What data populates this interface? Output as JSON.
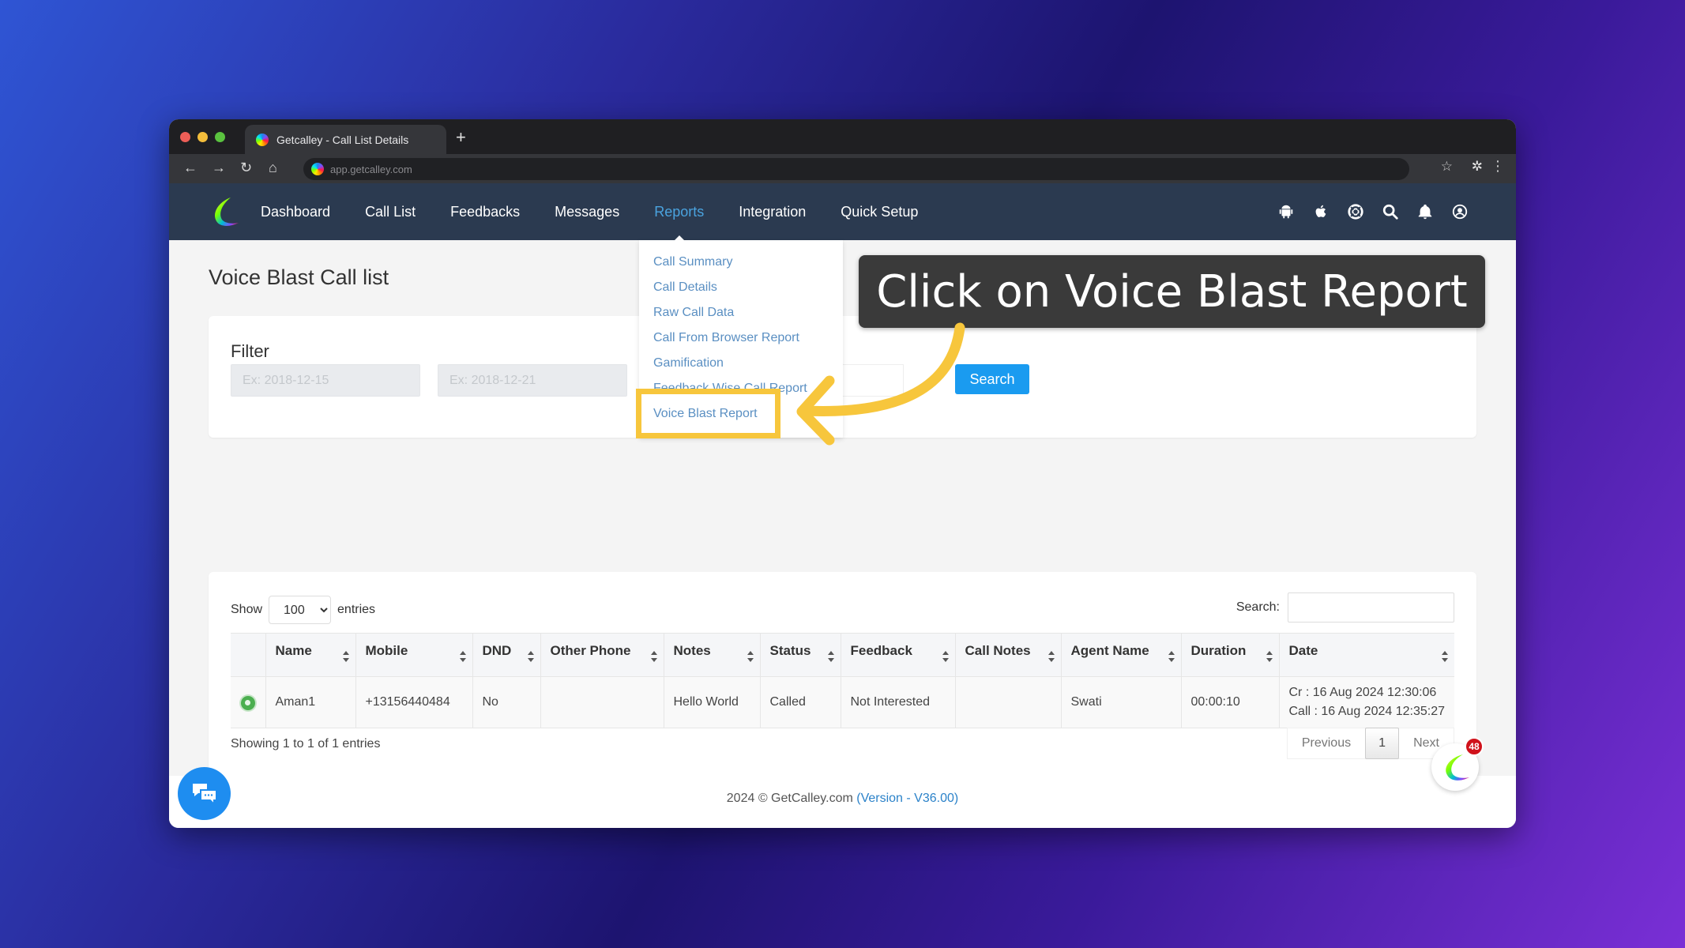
{
  "browser": {
    "tab_title": "Getcalley - Call List Details",
    "new_tab_icon": "plus-icon",
    "url": "app.getcalley.com",
    "nav_icons": [
      "back-arrow-icon",
      "forward-arrow-icon",
      "reload-icon",
      "home-icon"
    ],
    "right_icons": [
      "bookmark-star-icon",
      "extensions-puzzle-icon",
      "kebab-menu-icon"
    ]
  },
  "nav": {
    "items": [
      {
        "label": "Dashboard",
        "active": false
      },
      {
        "label": "Call List",
        "active": false
      },
      {
        "label": "Feedbacks",
        "active": false
      },
      {
        "label": "Messages",
        "active": false
      },
      {
        "label": "Reports",
        "active": true
      },
      {
        "label": "Integration",
        "active": false
      },
      {
        "label": "Quick Setup",
        "active": false
      }
    ],
    "right_icons": [
      "android-icon",
      "apple-icon",
      "support-lifebuoy-icon",
      "search-icon",
      "bell-icon",
      "user-account-icon"
    ]
  },
  "reports_menu": {
    "items": [
      "Call Summary",
      "Call Details",
      "Raw Call Data",
      "Call From Browser Report",
      "Gamification",
      "Feedback Wise Call Report",
      "Voice Blast Report"
    ],
    "highlighted": "Voice Blast Report"
  },
  "page": {
    "title": "Voice Blast Call list"
  },
  "filter": {
    "label": "Filter",
    "from_placeholder": "Ex: 2018-12-15",
    "to_placeholder": "Ex: 2018-12-21",
    "search_button": "Search"
  },
  "table": {
    "show_label": "Show",
    "entries_label": "entries",
    "page_size": "100",
    "search_label": "Search:",
    "search_value": "",
    "columns": [
      "",
      "Name",
      "Mobile",
      "DND",
      "Other Phone",
      "Notes",
      "Status",
      "Feedback",
      "Call Notes",
      "Agent Name",
      "Duration",
      "Date"
    ],
    "rows": [
      {
        "name": "Aman1",
        "mobile": "+13156440484",
        "dnd": "No",
        "other_phone": "",
        "notes": "Hello World",
        "status": "Called",
        "feedback": "Not Interested",
        "call_notes": "",
        "agent_name": "Swati",
        "duration": "00:00:10",
        "date_created": "Cr : 16 Aug 2024 12:30:06",
        "date_call": "Call : 16 Aug 2024 12:35:27"
      }
    ],
    "info": "Showing 1 to 1 of 1 entries",
    "pagination": {
      "previous": "Previous",
      "current": "1",
      "next": "Next"
    }
  },
  "footer": {
    "copyright": "2024 © GetCalley.com",
    "version": "(Version - V36.00)"
  },
  "widgets": {
    "chat_icon": "chat-bubbles-icon",
    "calley_badge_count": "48"
  },
  "annotation": {
    "callout_text": "Click on Voice Blast Report",
    "accent_color": "#f7c63c"
  },
  "colors": {
    "nav_bg": "#2b3a50",
    "link_blue": "#5a8fc2",
    "primary_button": "#1a9bf0",
    "active_nav": "#4aa3df"
  }
}
